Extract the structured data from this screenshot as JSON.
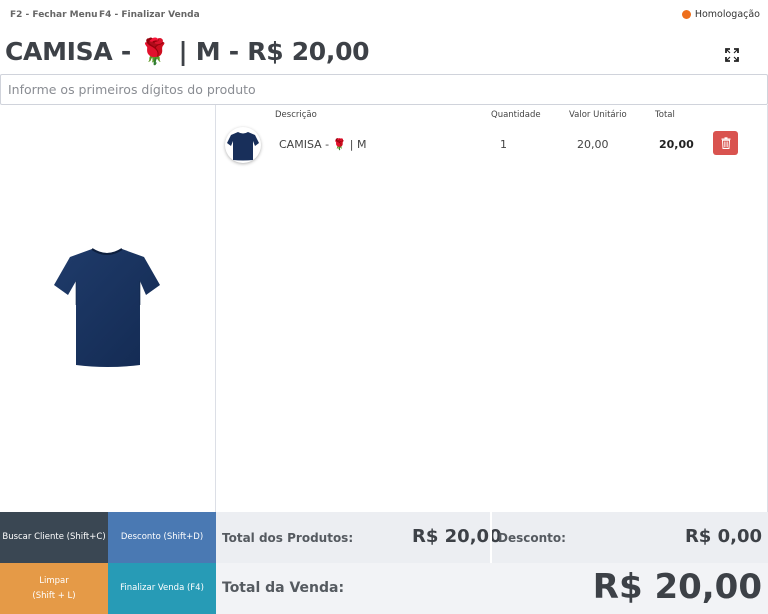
{
  "topbar": {
    "shortcut_close_menu": "F2 - Fechar Menu",
    "shortcut_finalize": "F4 - Finalizar Venda",
    "environment": "Homologação",
    "environment_color": "#ee6f1c"
  },
  "product": {
    "title": "CAMISA - 🌹 | M - R$ 20,00",
    "fullscreen_icon": "expand-icon",
    "image_icon": "tshirt-icon"
  },
  "search": {
    "placeholder": "Informe os primeiros dígitos do produto",
    "value": ""
  },
  "table": {
    "headers": {
      "description": "Descrição",
      "quantity": "Quantidade",
      "unit_price": "Valor Unitário",
      "total": "Total"
    },
    "rows": [
      {
        "description": "CAMISA - 🌹 | M",
        "quantity": "1",
        "unit_price": "20,00",
        "total": "20,00",
        "delete_icon": "trash-icon",
        "delete_color": "#d9534f"
      }
    ]
  },
  "actions": {
    "find_client": "Buscar Cliente (Shift+C)",
    "discount": "Desconto (Shift+D)",
    "clear_line1": "Limpar",
    "clear_line2": "(Shift + L)",
    "finalize": "Finalizar Venda (F4)"
  },
  "totals": {
    "products_label": "Total dos Produtos:",
    "products_value": "R$ 20,00",
    "discount_label": "Desconto:",
    "discount_value": "R$ 0,00",
    "sale_label": "Total da Venda:",
    "sale_value": "R$ 20,00"
  },
  "colors": {
    "btn_find_client": "#3a4753",
    "btn_discount": "#4a79b3",
    "btn_clear": "#e59a47",
    "btn_finalize": "#279bb6"
  }
}
